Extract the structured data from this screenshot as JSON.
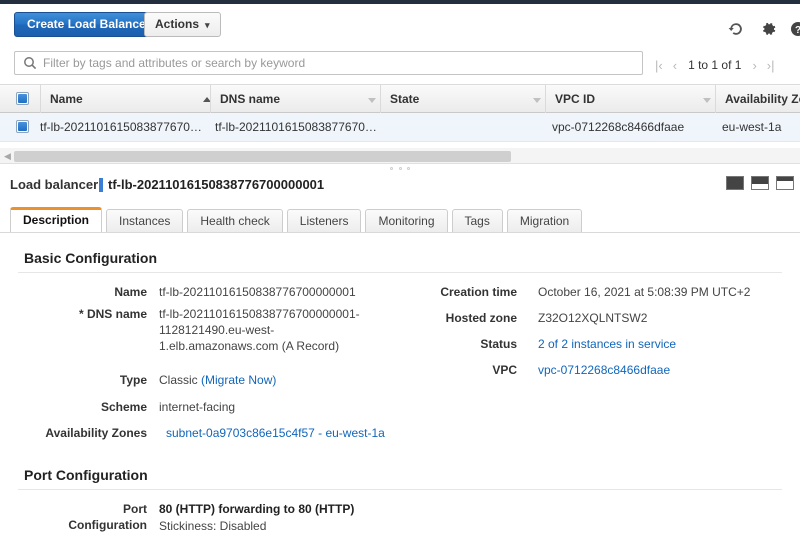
{
  "toolbar": {
    "create_label": "Create Load Balancer",
    "actions_label": "Actions",
    "caret": "▾",
    "refresh_icon": "refresh-icon",
    "gear_icon": "gear-icon",
    "help_icon": "help-icon"
  },
  "search": {
    "placeholder": "Filter by tags and attributes or search by keyword",
    "value": ""
  },
  "pagination": {
    "first": "|‹",
    "prev": "‹",
    "count": "1 to 1 of 1",
    "next": "›",
    "last": "›|"
  },
  "table": {
    "columns": [
      "Name",
      "DNS name",
      "State",
      "VPC ID",
      "Availability Zo"
    ],
    "rows": [
      {
        "name": "tf-lb-2021101615083877670…",
        "dns_name": "tf-lb-2021101615083877670…",
        "state": "",
        "vpc_id": "vpc-0712268c8466dfaae",
        "availability_zone": "eu-west-1a"
      }
    ]
  },
  "detail": {
    "header_label": "Load balancer:",
    "header_name": "tf-lb-20211016150838776700000001",
    "tabs": [
      {
        "label": "Description",
        "active": true
      },
      {
        "label": "Instances",
        "active": false
      },
      {
        "label": "Health check",
        "active": false
      },
      {
        "label": "Listeners",
        "active": false
      },
      {
        "label": "Monitoring",
        "active": false
      },
      {
        "label": "Tags",
        "active": false
      },
      {
        "label": "Migration",
        "active": false
      }
    ],
    "basic_configuration": {
      "title": "Basic Configuration",
      "name_label": "Name",
      "name_value": "tf-lb-20211016150838776700000001",
      "dns_label": "* DNS name",
      "dns_value": "tf-lb-20211016150838776700000001-1128121490.eu-west-1.elb.amazonaws.com (A Record)",
      "type_label": "Type",
      "type_value": "Classic",
      "type_link": "(Migrate Now)",
      "scheme_label": "Scheme",
      "scheme_value": "internet-facing",
      "az_label": "Availability Zones",
      "az_value": "subnet-0a9703c86e15c4f57 - eu-west-1a",
      "creation_label": "Creation time",
      "creation_value": "October 16, 2021 at 5:08:39 PM UTC+2",
      "hosted_zone_label": "Hosted zone",
      "hosted_zone_value": "Z32O12XQLNTSW2",
      "status_label": "Status",
      "status_value": "2 of 2 instances in service",
      "vpc_label": "VPC",
      "vpc_value": "vpc-0712268c8466dfaae"
    },
    "port_configuration": {
      "title": "Port Configuration",
      "label_line1": "Port",
      "label_line2": "Configuration",
      "value": "80 (HTTP) forwarding to 80 (HTTP)",
      "stickiness": "Stickiness: Disabled"
    }
  },
  "colors": {
    "accent_blue": "#1166bb",
    "button_blue": "#2372c4",
    "tab_active": "#ec912d",
    "nav_dark": "#232f3e",
    "row_selected": "#eff5fb"
  }
}
